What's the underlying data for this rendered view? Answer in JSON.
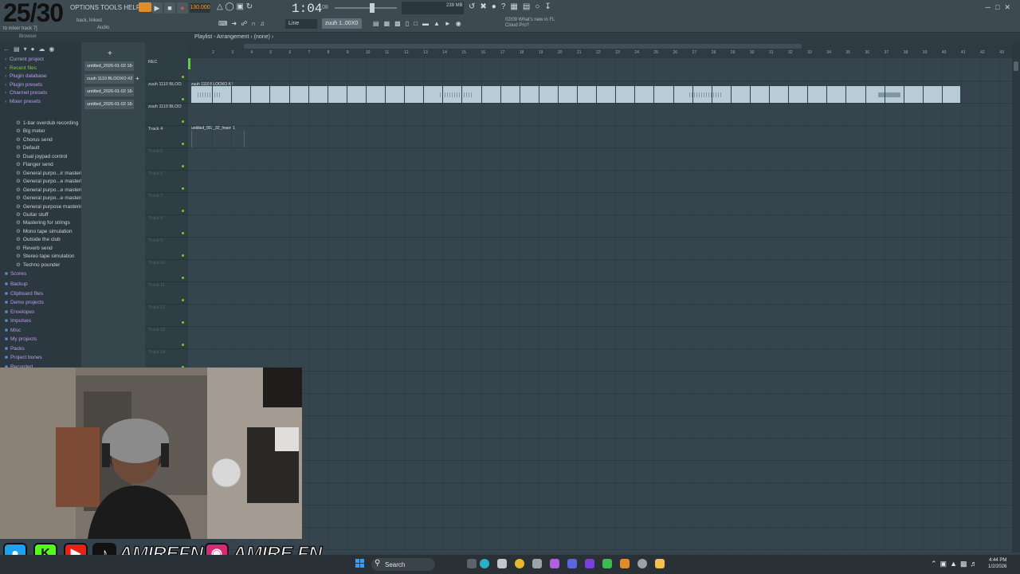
{
  "overlay": {
    "counter": "25/30"
  },
  "toolbar": {
    "menu": "OPTIONS TOOLS HELP",
    "hint_line1": "back, linked",
    "hint_line2": "to mixer track 7]",
    "hint_audio": "Audio",
    "tempo": "130.000",
    "time": "1:04",
    "time_sub": "08",
    "cpu_label": "239 MB",
    "snap": "Line",
    "pattern": "zuuh 1..00X0",
    "news_line1": "02/09  What's new in FL",
    "news_line2": "Cloud Pro?"
  },
  "playlist": {
    "title": "Playlist - Arrangement › (none) ›",
    "ruler": [
      "2",
      "3",
      "4",
      "5",
      "6",
      "7",
      "8",
      "9",
      "10",
      "11",
      "12",
      "13",
      "14",
      "15",
      "16",
      "17",
      "18",
      "19",
      "20",
      "21",
      "22",
      "23",
      "24",
      "25",
      "26",
      "27",
      "28",
      "29",
      "30",
      "31",
      "32",
      "33",
      "34",
      "35",
      "36",
      "37",
      "38",
      "39",
      "40",
      "41",
      "42",
      "43"
    ],
    "clip1_title": "zuuh 1110 BLOOXO #2",
    "clip2_title": "untitled_002_32_Insert 1"
  },
  "browser": {
    "label": "Browser",
    "items": [
      {
        "label": "Current project",
        "kind": "cat"
      },
      {
        "label": "Recent files",
        "kind": "green"
      },
      {
        "label": "Plugin database",
        "kind": "cat"
      },
      {
        "label": "Plugin presets",
        "kind": "cat"
      },
      {
        "label": "Channel presets",
        "kind": "cat"
      },
      {
        "label": "Mixer presets",
        "kind": "cat"
      }
    ],
    "mixer_presets": [
      "1-bar overdub recording",
      "Big meter",
      "Chorus send",
      "Default",
      "Dual joypad control",
      "Flanger send",
      "General purpo...ir mastering",
      "General purpo...e mastering 2",
      "General purpo...e mastering 3",
      "General purpo...e mastering 4",
      "General purpose mastering",
      "Guitar stuff",
      "Mastering for strings",
      "Mono tape simulation",
      "Outside the club",
      "Reverb send",
      "Stereo tape simulation",
      "Techno pounder"
    ],
    "folders": [
      {
        "label": "Scores"
      },
      {
        "label": "Backup"
      },
      {
        "label": "Clipboard files"
      },
      {
        "label": "Demo projects"
      },
      {
        "label": "Envelopes"
      },
      {
        "label": "Impulses"
      },
      {
        "label": "Misc"
      },
      {
        "label": "My projects"
      },
      {
        "label": "Packs"
      },
      {
        "label": "Project bones"
      },
      {
        "label": "Recorded"
      }
    ]
  },
  "picker": {
    "items": [
      "untitled_2026-01-02 16-",
      "zuuh 1110 BLOOXO #2",
      "untitled_2026-01-02 16-",
      "untitled_2026-01-02 16-"
    ]
  },
  "tracks": {
    "items": [
      {
        "label": "REC",
        "dim": false
      },
      {
        "label": "zuuh 1110 BLOO",
        "dim": false
      },
      {
        "label": "zuuh 1110 BLOO",
        "dim": false
      },
      {
        "label": "Track 4",
        "dim": false
      },
      {
        "label": "Track 5",
        "dim": true
      },
      {
        "label": "Track 6",
        "dim": true
      },
      {
        "label": "Track 7",
        "dim": true
      },
      {
        "label": "Track 8",
        "dim": true
      },
      {
        "label": "Track 9",
        "dim": true
      },
      {
        "label": "Track 10",
        "dim": true
      },
      {
        "label": "Track 11",
        "dim": true
      },
      {
        "label": "Track 12",
        "dim": true
      },
      {
        "label": "Track 13",
        "dim": true
      },
      {
        "label": "Track 14",
        "dim": true
      }
    ]
  },
  "social": {
    "handle1": "AMIREFN",
    "handle2": "AMIRE.FN",
    "icons": [
      "twitter-icon",
      "kick-icon",
      "youtube-icon",
      "tiktok-icon",
      "instagram-icon"
    ]
  },
  "taskbar": {
    "search": "Search",
    "time": "4:44 PM",
    "date": "1/2/2026"
  },
  "colors": {
    "accent": "#e08c2c",
    "clip": "#b7ccd6",
    "track_led": "#7ac943",
    "browser_category": "#b99ee8"
  }
}
